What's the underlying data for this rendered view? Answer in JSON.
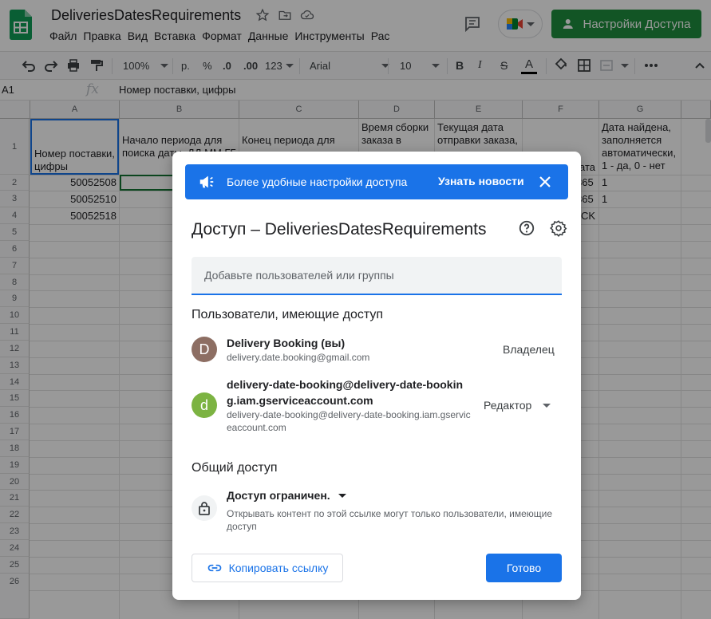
{
  "window": {
    "doc_title": "DeliveriesDatesRequirements",
    "menu": [
      "Файл",
      "Правка",
      "Вид",
      "Вставка",
      "Формат",
      "Данные",
      "Инструменты",
      "Рас"
    ],
    "share_label": "Настройки Доступа"
  },
  "toolbar": {
    "zoom": "100%",
    "currency": "р.",
    "percent": "%",
    "dec_less": ".0",
    "dec_more": ".00",
    "format_more": "123",
    "font": "Arial",
    "font_size": "10",
    "bold": "B",
    "italic": "I",
    "strike": "S",
    "text_color": "A"
  },
  "formula_bar": {
    "cell_ref": "A1",
    "fx": "fx",
    "value": "Номер поставки, цифры"
  },
  "grid": {
    "columns": [
      "A",
      "B",
      "C",
      "D",
      "E",
      "F",
      "G"
    ],
    "row_numbers": [
      "1",
      "2",
      "3",
      "4",
      "5",
      "6",
      "7",
      "8",
      "9",
      "10",
      "11",
      "12",
      "13",
      "14",
      "15",
      "16",
      "17",
      "18",
      "19",
      "20",
      "21",
      "22",
      "23",
      "24",
      "25",
      "26"
    ],
    "header_cells": {
      "a": "Номер поставки, цифры",
      "b": "Начало периода для поиска даты, ДД.ММ.ГГ",
      "c": "Конец периода для",
      "d": "Время сборки заказа в",
      "e": "Текущая дата отправки заказа,",
      "f_suffix": "ата",
      "g": "Дата найдена, заполняется автоматически, 1 - да, 0 - нет"
    },
    "rows": [
      {
        "a": "50052508",
        "f": "365",
        "g": "1"
      },
      {
        "a": "50052510",
        "f": "365",
        "g": "1"
      },
      {
        "a": "50052518",
        "f": "CK",
        "g": ""
      }
    ]
  },
  "dialog": {
    "banner_text": "Более удобные настройки доступа",
    "banner_link": "Узнать новости",
    "title": "Доступ – DeliveriesDatesRequirements",
    "add_placeholder": "Добавьте пользователей или группы",
    "users_heading": "Пользователи, имеющие доступ",
    "users": [
      {
        "initial": "D",
        "name": "Delivery Booking (вы)",
        "email": "delivery.date.booking@gmail.com",
        "role": "Владелец",
        "avatar_color": "#8d6e63"
      },
      {
        "initial": "d",
        "name": "delivery-date-booking@delivery-date-booking.iam.gserviceaccount.com",
        "email": "delivery-date-booking@delivery-date-booking.iam.gserviceaccount.com",
        "role": "Редактор",
        "avatar_color": "#7cb342"
      }
    ],
    "general_heading": "Общий доступ",
    "access_level": "Доступ ограничен.",
    "access_description": "Открывать контент по этой ссылке могут только пользователи, имеющие доступ",
    "copy_link_label": "Копировать ссылку",
    "done_label": "Готово"
  },
  "colors": {
    "primary": "#1a73e8",
    "share_green": "#1e8e3e",
    "overlay": "rgba(0,0,0,0.40)"
  }
}
